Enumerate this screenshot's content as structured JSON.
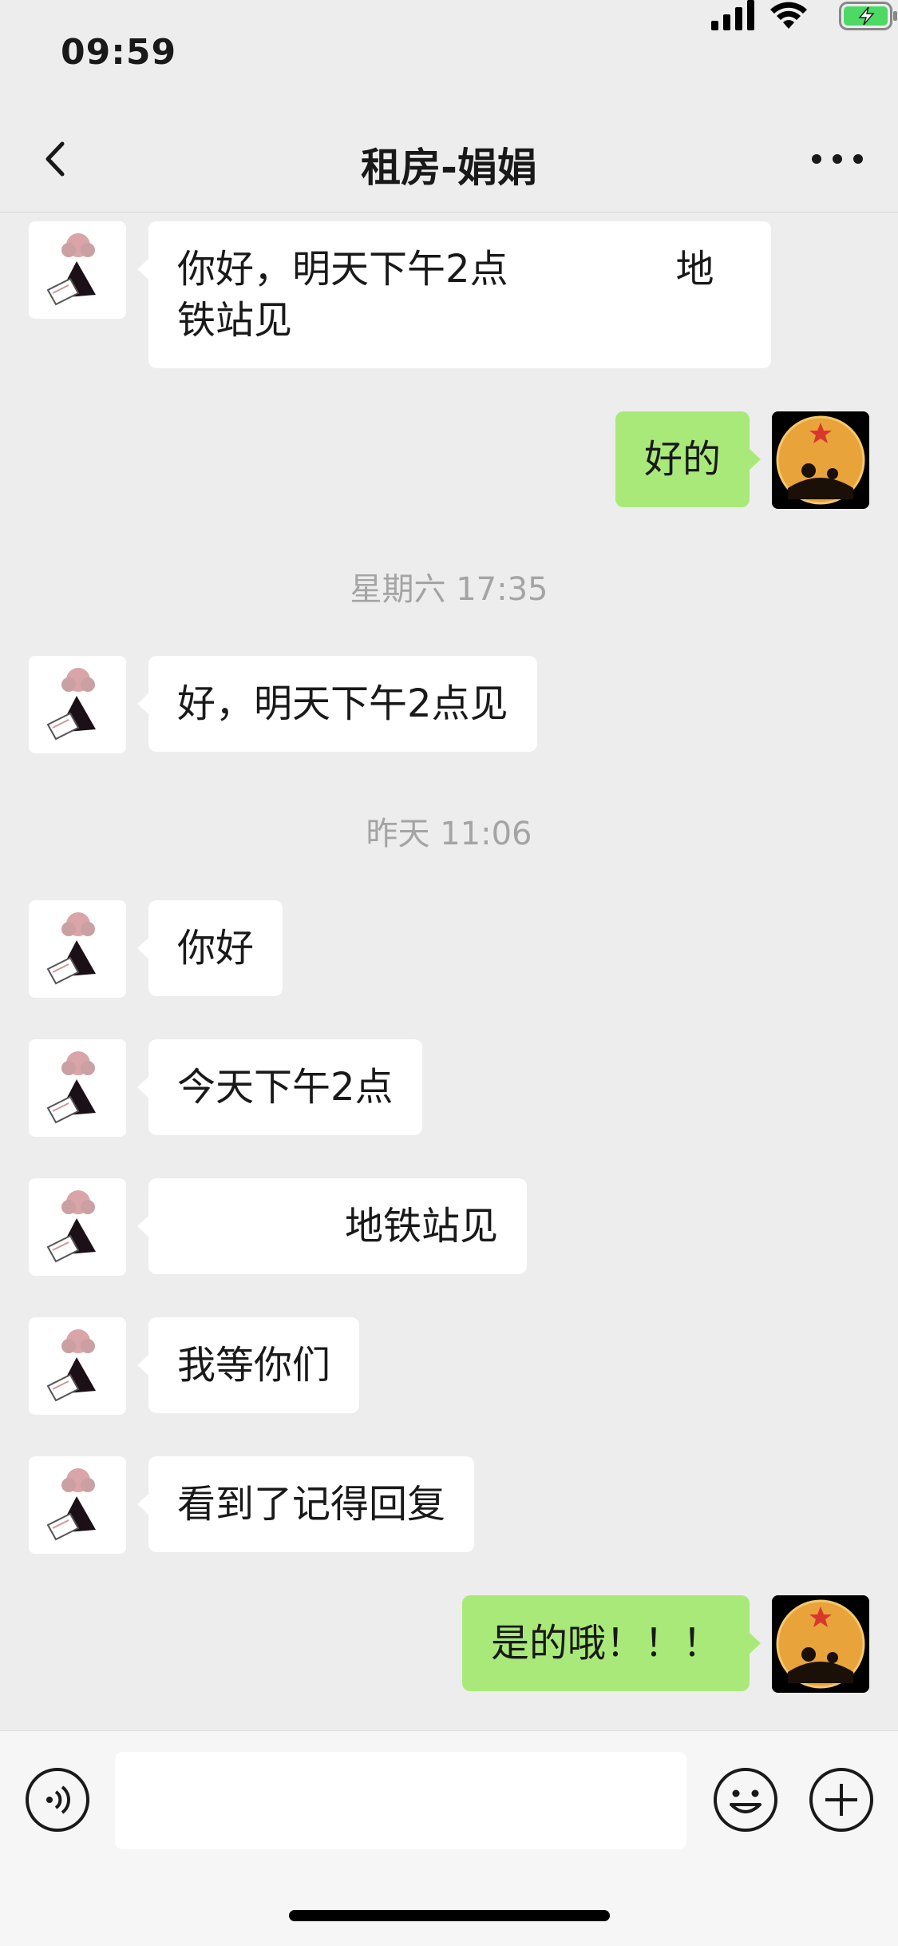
{
  "status_bar": {
    "time": "09:59"
  },
  "header": {
    "title": "租房-娟娟"
  },
  "messages": [
    {
      "side": "left",
      "text": "你好，明天下午2点",
      "text2": "地\n铁站见"
    },
    {
      "side": "right",
      "text": "好的"
    },
    {
      "timestamp": "星期六 17:35"
    },
    {
      "side": "left",
      "text": "好，明天下午2点见"
    },
    {
      "timestamp": "昨天 11:06"
    },
    {
      "side": "left",
      "text": "你好"
    },
    {
      "side": "left",
      "text": "今天下午2点"
    },
    {
      "side": "left",
      "text": "地铁站见"
    },
    {
      "side": "left",
      "text": "我等你们"
    },
    {
      "side": "left",
      "text": "看到了记得回复"
    },
    {
      "side": "right",
      "text": "是的哦！！！"
    }
  ],
  "input": {
    "placeholder": ""
  },
  "colors": {
    "background": "#ededed",
    "outgoing_bubble": "#a9e979",
    "incoming_bubble": "#ffffff"
  }
}
